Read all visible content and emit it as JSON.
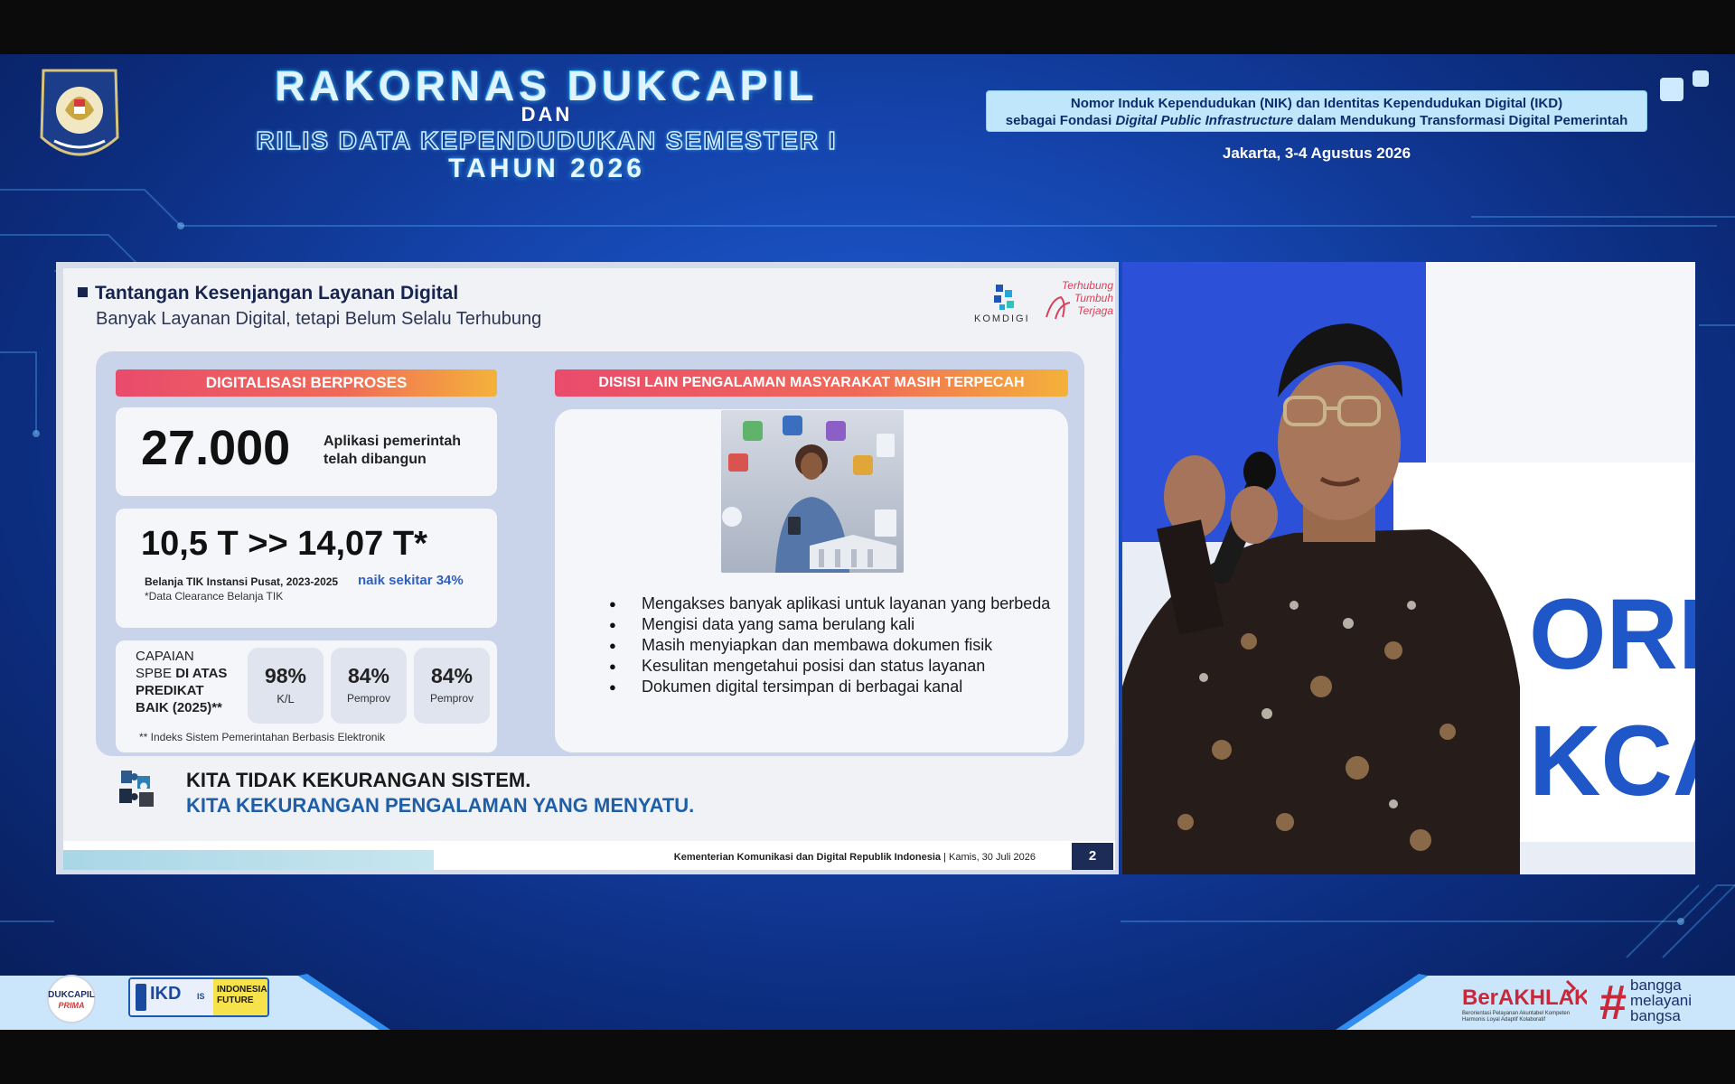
{
  "header": {
    "title_line1": "RAKORNAS DUKCAPIL",
    "title_dan": "DAN",
    "title_line2": "RILIS DATA KEPENDUDUKAN SEMESTER I",
    "title_line3": "TAHUN 2026",
    "theme_line1": "Nomor Induk Kependudukan (NIK) dan Identitas Kependudukan Digital (IKD)",
    "theme_line2_pre": "sebagai Fondasi ",
    "theme_line2_em": "Digital Public Infrastructure",
    "theme_line2_post": " dalam Mendukung Transformasi Digital Pemerintah",
    "event_date": "Jakarta, 3-4 Agustus 2026"
  },
  "slide": {
    "title": "Tantangan Kesenjangan Layanan Digital",
    "subtitle": "Banyak Layanan Digital, tetapi Belum Selalu Terhubung",
    "komdigi_label": "KOMDIGI",
    "tagline": [
      "Terhubung",
      "Tumbuh",
      "Terjaga"
    ],
    "left_header": "DIGITALISASI BERPROSES",
    "right_header": "DISISI LAIN PENGALAMAN MASYARAKAT MASIH TERPECAH",
    "apps": {
      "number": "27.000",
      "desc_line1": "Aplikasi pemerintah",
      "desc_line2": "telah dibangun"
    },
    "spending": {
      "value": "10,5 T >> 14,07 T*",
      "label": "Belanja TIK Instansi Pusat, 2023-2025",
      "increase": "naik sekitar 34%",
      "note": "*Data Clearance Belanja TIK"
    },
    "spbe": {
      "label_line1": "CAPAIAN",
      "label_line2_pre": "SPBE ",
      "label_line2_bold": "DI ATAS",
      "label_line3": "PREDIKAT",
      "label_line4": "BAIK (2025)**",
      "stats": [
        {
          "value": "98%",
          "unit": "K/L"
        },
        {
          "value": "84%",
          "unit": "Pemprov"
        },
        {
          "value": "84%",
          "unit": "Pemprov"
        }
      ],
      "footnote": "** Indeks Sistem Pemerintahan Berbasis Elektronik"
    },
    "experience_items": [
      "Mengakses banyak aplikasi untuk layanan yang berbeda",
      "Mengisi data yang sama berulang kali",
      "Masih menyiapkan dan membawa dokumen fisik",
      "Kesulitan mengetahui posisi dan status layanan",
      "Dokumen digital tersimpan di berbagai kanal"
    ],
    "conclusion_line1": "KITA TIDAK KEKURANGAN SISTEM.",
    "conclusion_line2": "KITA KEKURANGAN PENGALAMAN YANG MENYATU.",
    "footer_org": "Kementerian Komunikasi dan Digital Republik Indonesia",
    "footer_date": " | Kamis, 30 Juli 2026",
    "page_number": "2"
  },
  "video": {
    "backdrop_text_1": "ORI",
    "backdrop_text_2": "KCA"
  },
  "bottom": {
    "dukcapil_logo_text": "DUKCAPIL",
    "dukcapil_logo_sub": "PRIMA",
    "ikd_text": "IKD",
    "ikd_is": "IS",
    "ikd_future_line1": "INDONESIA'S",
    "ikd_future_line2": "FUTURE",
    "berakhlak": "BerAKHLAK",
    "berakhlak_sub_line1": "Berorientasi Pelayanan Akuntabel Kompeten",
    "berakhlak_sub_line2": "Harmonis Loyal Adaptif Kolaboratif",
    "bangga_hash": "#",
    "bangga_line1": "bangga",
    "bangga_line2": "melayani",
    "bangga_line3": "bangsa"
  },
  "colors": {
    "accent_pink": "#e94b6c",
    "accent_orange": "#f4b23a",
    "navy": "#17244d",
    "blue_text": "#1e5fa8",
    "stage_blue": "#1546b0"
  }
}
